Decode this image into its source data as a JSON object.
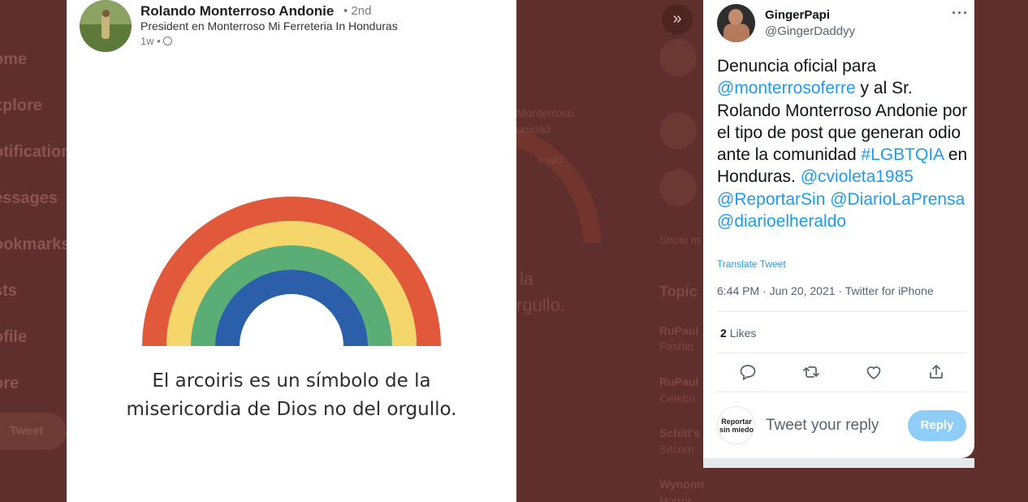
{
  "background": {
    "nav_items": [
      "ome",
      "xplore",
      "otifications",
      "essages",
      "ookmarks",
      "sts",
      "ofile",
      "ore"
    ],
    "tweet_button": "Tweet",
    "ghost_texts": [
      "Monterroso",
      "unidad",
      "erado",
      "Show m",
      "Topic",
      "RuPaul",
      "Fashio",
      "RuPaul",
      "Celebri",
      "Schitt's",
      "Sitcom",
      "Wynonn",
      "Horror"
    ],
    "ghost_large": [
      "la",
      "rgullo."
    ]
  },
  "post": {
    "author_name": "Rolando Monterroso Andonie",
    "connection_degree": "• 2nd",
    "headline": "President en Monterroso Mi Ferreteria In Honduras",
    "time": "1w •",
    "rainbow_colors": [
      "#e2583a",
      "#f5d66a",
      "#5aad74",
      "#2c5faa"
    ],
    "caption_line1": "El arcoiris es un símbolo de la",
    "caption_line2": "misericordia de Dios no del orgullo."
  },
  "tweet": {
    "display_name": "GingerPapi",
    "handle": "@GingerDaddyy",
    "text_segments": [
      {
        "t": "Denuncia oficial para ",
        "link": false
      },
      {
        "t": "@monterrosoferre",
        "link": true
      },
      {
        "t": " y al Sr. Rolando Monterroso Andonie por el tipo de post que generan odio ante la comunidad ",
        "link": false
      },
      {
        "t": "#LGBTQIA",
        "link": true
      },
      {
        "t": " en Honduras. ",
        "link": false
      },
      {
        "t": "@cvioleta1985",
        "link": true
      },
      {
        "t": " ",
        "link": false
      },
      {
        "t": "@ReportarSin",
        "link": true
      },
      {
        "t": " ",
        "link": false
      },
      {
        "t": "@DiarioLaPrensa",
        "link": true
      },
      {
        "t": " ",
        "link": false
      },
      {
        "t": "@diarioelheraldo",
        "link": true
      }
    ],
    "translate_label": "Translate Tweet",
    "timestamp": "6:44 PM · Jun 20, 2021 · Twitter for iPhone",
    "likes_count": "2",
    "likes_label": "Likes",
    "reply_avatar_text": "Reportar sin miedo",
    "reply_placeholder": "Tweet your reply",
    "reply_button": "Reply",
    "accent_color": "#1d9bf0"
  }
}
